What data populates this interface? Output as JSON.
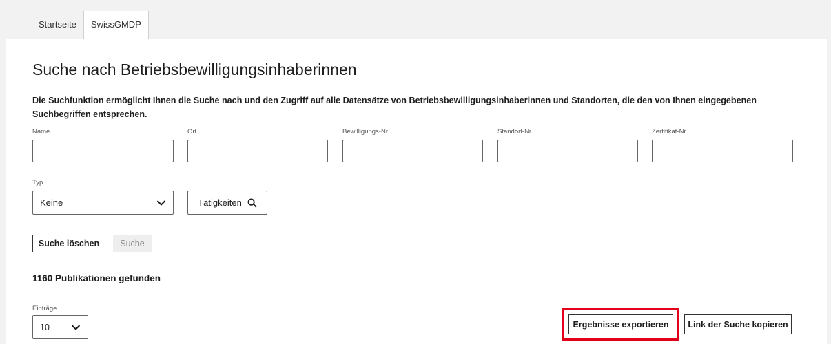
{
  "tabs": [
    {
      "label": "Startseite",
      "active": false
    },
    {
      "label": "SwissGMDP",
      "active": true
    }
  ],
  "page": {
    "title": "Suche nach Betriebsbewilligungsinhaberinnen",
    "description": "Die Suchfunktion ermöglicht Ihnen die Suche nach und den Zugriff auf alle Datensätze von Betriebsbewilligungsinhaberinnen und Standorten, die den von Ihnen eingegebenen Suchbegriffen entsprechen."
  },
  "fields": [
    {
      "label": "Name",
      "value": ""
    },
    {
      "label": "Ort",
      "value": ""
    },
    {
      "label": "Bewilligungs-Nr.",
      "value": ""
    },
    {
      "label": "Standort-Nr.",
      "value": ""
    },
    {
      "label": "Zertifikat-Nr.",
      "value": ""
    }
  ],
  "type_filter": {
    "label": "Typ",
    "selected": "Keine"
  },
  "buttons": {
    "activities": "Tätigkeiten",
    "clear": "Suche löschen",
    "search": "Suche",
    "export": "Ergebnisse exportieren",
    "copy_link": "Link der Suche kopieren"
  },
  "results": {
    "summary": "1160 Publikationen gefunden"
  },
  "entries": {
    "label": "Einträge",
    "selected": "10"
  },
  "colors": {
    "accent_red": "#e2001a",
    "top_line": "#c8102e"
  }
}
